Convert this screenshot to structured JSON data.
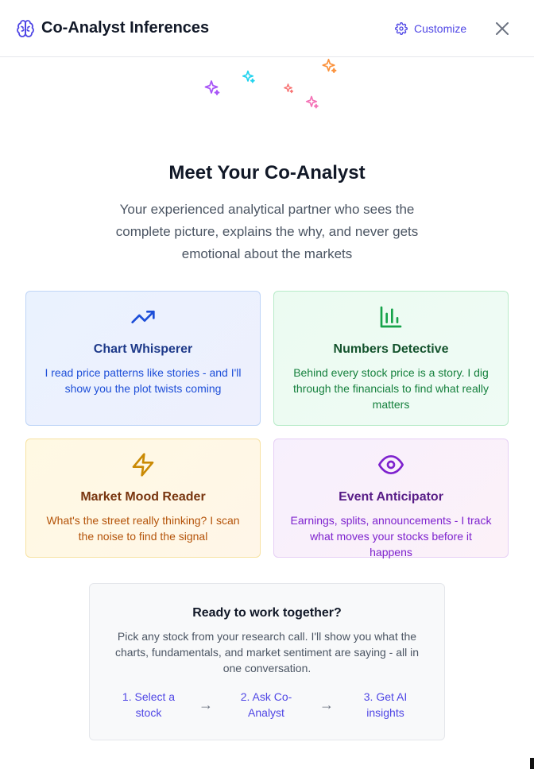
{
  "header": {
    "title": "Co-Analyst Inferences",
    "customize_label": "Customize"
  },
  "hero": {
    "title": "Meet Your Co-Analyst",
    "subtitle": "Your experienced analytical partner who sees the complete picture, explains the why, and never gets emotional about the markets"
  },
  "cards": [
    {
      "icon": "trending-up-icon",
      "title": "Chart Whisperer",
      "description": "I read price patterns like stories - and I'll show you the plot twists coming",
      "accent": "#1d4ed8"
    },
    {
      "icon": "bar-chart-icon",
      "title": "Numbers Detective",
      "description": "Behind every stock price is a story. I dig through the financials to find what really matters",
      "accent": "#16a34a"
    },
    {
      "icon": "lightning-icon",
      "title": "Market Mood Reader",
      "description": "What's the street really thinking? I scan the noise to find the signal",
      "accent": "#ca8a04"
    },
    {
      "icon": "eye-icon",
      "title": "Event Anticipator",
      "description": "Earnings, splits, announcements - I track what moves your stocks before it happens",
      "accent": "#7e22ce"
    }
  ],
  "ready": {
    "title": "Ready to work together?",
    "description": "Pick any stock from your research call. I'll show you what the charts, fundamentals, and market sentiment are saying - all in one conversation.",
    "steps": [
      "1. Select a stock",
      "2. Ask Co-Analyst",
      "3. Get AI insights"
    ],
    "arrow": "→"
  },
  "colors": {
    "primary": "#4f46e5",
    "sparkles": [
      "#a855f7",
      "#22d3ee",
      "#f87171",
      "#fb923c",
      "#f472b6"
    ]
  }
}
